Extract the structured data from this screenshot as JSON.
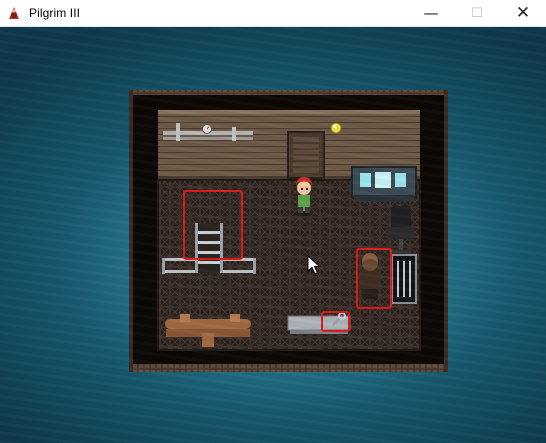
{
  "window": {
    "title": "Pilgrim III",
    "minimize_glyph": "—",
    "maximize_glyph": "☐",
    "close_glyph": "✕"
  },
  "icons": {
    "app": "pilgrim-app-icon",
    "cursor": "mouse-pointer-icon"
  },
  "scene": {
    "room": "engine room interior",
    "objects": [
      "wall pipes",
      "pressure gauge",
      "yellow wall lamp",
      "ventilation grate",
      "red-haired hero",
      "control console",
      "black swivel chair",
      "railing",
      "metal staircase",
      "brown-haired crew member",
      "open doorway",
      "copper pipes",
      "metal workbench",
      "wrench"
    ],
    "highlighted": [
      "metal staircase",
      "brown-haired crew member",
      "wrench"
    ]
  },
  "colors": {
    "highlight": "#e01a1a",
    "water_light": "#3a98b0",
    "water_dark": "#0d3a4c",
    "wall_wood": "#6e5a47",
    "floor_grate": "#3b2f2a"
  }
}
